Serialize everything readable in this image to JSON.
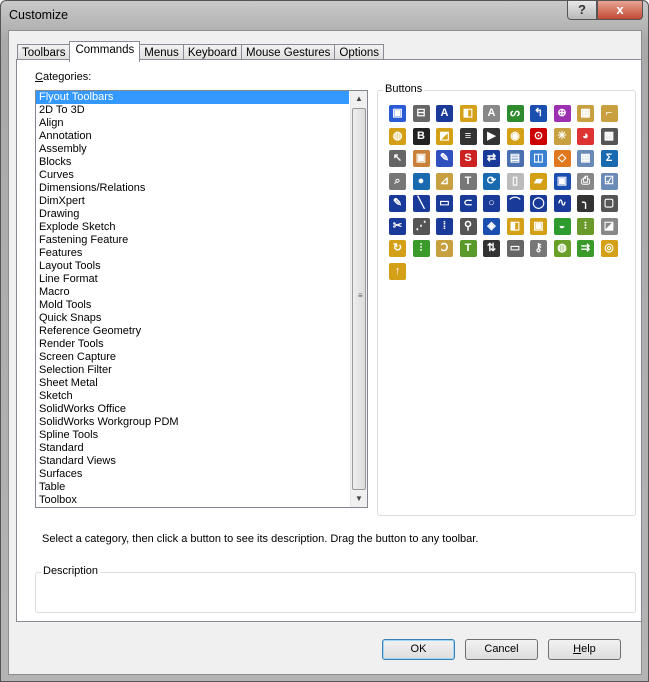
{
  "window": {
    "title": "Customize",
    "help_label": "?",
    "close_label": "x"
  },
  "tabs": [
    "Toolbars",
    "Commands",
    "Menus",
    "Keyboard",
    "Mouse Gestures",
    "Options"
  ],
  "active_tab": "Commands",
  "categories": {
    "label_first": "C",
    "label_rest": "ategories:",
    "selected": "Flyout Toolbars",
    "items": [
      "Flyout Toolbars",
      "2D To 3D",
      "Align",
      "Annotation",
      "Assembly",
      "Blocks",
      "Curves",
      "Dimensions/Relations",
      "DimXpert",
      "Drawing",
      "Explode Sketch",
      "Fastening Feature",
      "Features",
      "Layout Tools",
      "Line Format",
      "Macro",
      "Mold Tools",
      "Quick Snaps",
      "Reference Geometry",
      "Render Tools",
      "Screen Capture",
      "Selection Filter",
      "Sheet Metal",
      "Sketch",
      "SolidWorks Office",
      "SolidWorks Workgroup PDM",
      "Spline Tools",
      "Standard",
      "Standard Views",
      "Surfaces",
      "Table",
      "Toolbox"
    ]
  },
  "buttons_group": {
    "label": "Buttons",
    "icons": [
      {
        "name": "2d-to-3d",
        "c": "#2a5bd7",
        "g": "▣"
      },
      {
        "name": "align",
        "c": "#666",
        "g": "⊟"
      },
      {
        "name": "annotation",
        "c": "#1a3a9a",
        "g": "A"
      },
      {
        "name": "assembly",
        "c": "#d4a017",
        "g": "◧"
      },
      {
        "name": "note",
        "c": "#888",
        "g": "A"
      },
      {
        "name": "curves",
        "c": "#2e8b2e",
        "g": "ᔕ"
      },
      {
        "name": "dimensions",
        "c": "#1a4fb0",
        "g": "↰"
      },
      {
        "name": "dimxpert",
        "c": "#9b30b0",
        "g": "⊕"
      },
      {
        "name": "drawing",
        "c": "#c8a040",
        "g": "▦"
      },
      {
        "name": "explode-sketch",
        "c": "#c8a040",
        "g": "⌐"
      },
      {
        "name": "fastening",
        "c": "#d4a017",
        "g": "◍"
      },
      {
        "name": "format",
        "c": "#222",
        "g": "B"
      },
      {
        "name": "features",
        "c": "#d4a017",
        "g": "◩"
      },
      {
        "name": "line-format",
        "c": "#333",
        "g": "≡"
      },
      {
        "name": "macro",
        "c": "#333",
        "g": "▶"
      },
      {
        "name": "mold-tools",
        "c": "#d4a017",
        "g": "◉"
      },
      {
        "name": "quick-snaps",
        "c": "#c00",
        "g": "⊙"
      },
      {
        "name": "reference-geometry",
        "c": "#c8a040",
        "g": "✳"
      },
      {
        "name": "render",
        "c": "#d33",
        "g": "◕"
      },
      {
        "name": "screen-capture",
        "c": "#555",
        "g": "▩"
      },
      {
        "name": "selection-filter",
        "c": "#666",
        "g": "↖"
      },
      {
        "name": "sheet-metal",
        "c": "#c8803a",
        "g": "▣"
      },
      {
        "name": "sketch",
        "c": "#3050c0",
        "g": "✎"
      },
      {
        "name": "solidworks-office",
        "c": "#c22",
        "g": "S"
      },
      {
        "name": "workgroup-pdm",
        "c": "#1a3a9a",
        "g": "⇄"
      },
      {
        "name": "spline",
        "c": "#4a70b0",
        "g": "▤"
      },
      {
        "name": "standard-views",
        "c": "#3a7fd0",
        "g": "◫"
      },
      {
        "name": "surfaces",
        "c": "#e07820",
        "g": "◇"
      },
      {
        "name": "table",
        "c": "#6a8ab8",
        "g": "▦"
      },
      {
        "name": "toolbox",
        "c": "#1a6ab0",
        "g": "Σ"
      },
      {
        "name": "view",
        "c": "#777",
        "g": "⌕"
      },
      {
        "name": "web",
        "c": "#1a6ab0",
        "g": "●"
      },
      {
        "name": "weldments",
        "c": "#c8a040",
        "g": "⊿"
      },
      {
        "name": "hole",
        "c": "#777",
        "g": "T"
      },
      {
        "name": "rebuild",
        "c": "#1a6ab0",
        "g": "⟳"
      },
      {
        "name": "new",
        "c": "#bbb",
        "g": "▯"
      },
      {
        "name": "open",
        "c": "#d4a017",
        "g": "▰"
      },
      {
        "name": "save",
        "c": "#1a4fb0",
        "g": "▣"
      },
      {
        "name": "print",
        "c": "#888",
        "g": "⎙"
      },
      {
        "name": "options",
        "c": "#6a8ab8",
        "g": "☑"
      },
      {
        "name": "sketch-tool",
        "c": "#1a3a9a",
        "g": "✎"
      },
      {
        "name": "line",
        "c": "#1a3a9a",
        "g": "╲"
      },
      {
        "name": "rectangle",
        "c": "#1a3a9a",
        "g": "▭"
      },
      {
        "name": "slot",
        "c": "#1a3a9a",
        "g": "⊂"
      },
      {
        "name": "circle",
        "c": "#1a3a9a",
        "g": "○"
      },
      {
        "name": "arc",
        "c": "#1a3a9a",
        "g": "⌒"
      },
      {
        "name": "ellipse",
        "c": "#1a3a9a",
        "g": "◯"
      },
      {
        "name": "spline-curve",
        "c": "#1a3a9a",
        "g": "∿"
      },
      {
        "name": "fillet",
        "c": "#333",
        "g": "╮"
      },
      {
        "name": "cube",
        "c": "#555",
        "g": "▢"
      },
      {
        "name": "trim",
        "c": "#1a3a9a",
        "g": "✂"
      },
      {
        "name": "convert",
        "c": "#555",
        "g": "⋰"
      },
      {
        "name": "pattern",
        "c": "#1a3a9a",
        "g": "⁞"
      },
      {
        "name": "mirror",
        "c": "#555",
        "g": "⚲"
      },
      {
        "name": "tag",
        "c": "#1a4fb0",
        "g": "◈"
      },
      {
        "name": "component",
        "c": "#d4a017",
        "g": "◧"
      },
      {
        "name": "mate",
        "c": "#d4a017",
        "g": "▣"
      },
      {
        "name": "move",
        "c": "#2e9b2e",
        "g": "◒"
      },
      {
        "name": "smart-fastener",
        "c": "#6a9a2a",
        "g": "⁝"
      },
      {
        "name": "interference",
        "c": "#888",
        "g": "◪"
      },
      {
        "name": "open-assembly",
        "c": "#d4a017",
        "g": "↻"
      },
      {
        "name": "explode",
        "c": "#3a9a2a",
        "g": "⫶"
      },
      {
        "name": "hinge",
        "c": "#c8a040",
        "g": "Ↄ"
      },
      {
        "name": "toolbox-hole",
        "c": "#5a9a2a",
        "g": "T"
      },
      {
        "name": "swap",
        "c": "#333",
        "g": "⇅"
      },
      {
        "name": "monitor",
        "c": "#666",
        "g": "▭"
      },
      {
        "name": "pins",
        "c": "#777",
        "g": "⚷"
      },
      {
        "name": "parts",
        "c": "#6aa02a",
        "g": "◍"
      },
      {
        "name": "compare",
        "c": "#3a9a2a",
        "g": "⇉"
      },
      {
        "name": "coins",
        "c": "#d4a017",
        "g": "◎"
      },
      {
        "name": "costing",
        "c": "#d4a017",
        "g": "↑"
      }
    ]
  },
  "instruction": "Select a category, then click a button to see its description. Drag the button to any toolbar.",
  "description": {
    "label": "Description",
    "text": ""
  },
  "footer": {
    "ok": "OK",
    "cancel": "Cancel",
    "help_first": "H",
    "help_rest": "elp"
  }
}
